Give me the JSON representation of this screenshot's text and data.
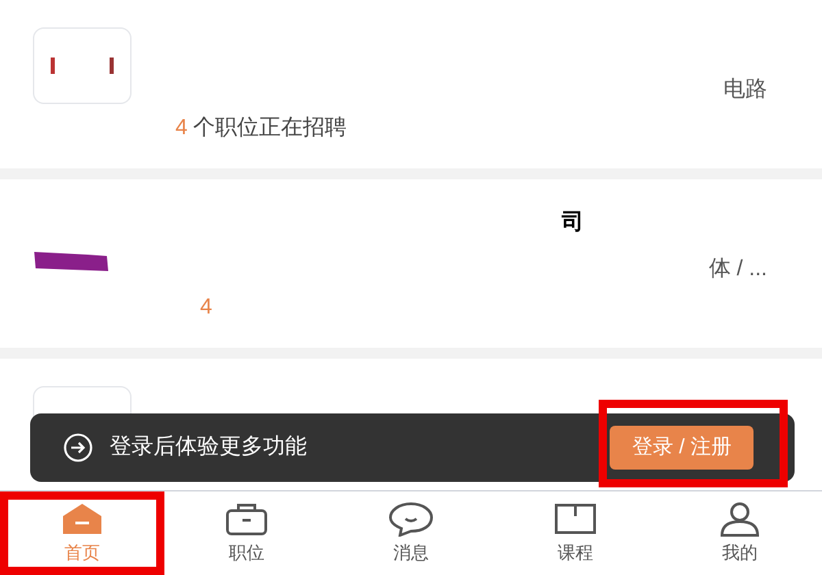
{
  "companies": [
    {
      "kind": "plain",
      "tags": "电路",
      "count": "4",
      "count_text": "个职位正在招聘"
    },
    {
      "kind": "smear",
      "title": "司",
      "tags": "体 / ...",
      "count": "4"
    },
    {
      "kind": "plain"
    }
  ],
  "toast": {
    "text": "登录后体验更多功能",
    "button": "登录 / 注册",
    "highlighted": true
  },
  "tabs": [
    {
      "label": "首页",
      "selected": true,
      "highlighted": true
    },
    {
      "label": "职位",
      "selected": false,
      "highlighted": false
    },
    {
      "label": "消息",
      "selected": false,
      "highlighted": false
    },
    {
      "label": "课程",
      "selected": false,
      "highlighted": false
    },
    {
      "label": "我的",
      "selected": false,
      "highlighted": false
    }
  ]
}
